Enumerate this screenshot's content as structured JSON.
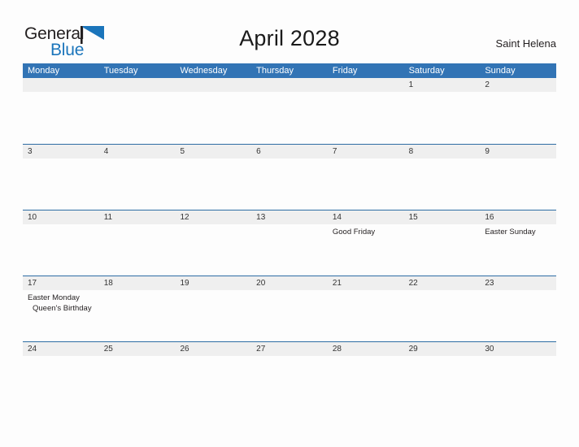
{
  "brand": {
    "word_one": "General",
    "word_two": "Blue",
    "flag_icon": "blue-flag-icon",
    "dark_color": "#231f20",
    "blue_color": "#1b75bb"
  },
  "header": {
    "title": "April 2028",
    "location": "Saint Helena"
  },
  "calendar": {
    "accent_color": "#3274b5",
    "band_color": "#efefef",
    "divider_color": "#2e6da4",
    "weekdays": [
      "Monday",
      "Tuesday",
      "Wednesday",
      "Thursday",
      "Friday",
      "Saturday",
      "Sunday"
    ],
    "weeks": [
      {
        "days": [
          {
            "num": "",
            "events": []
          },
          {
            "num": "",
            "events": []
          },
          {
            "num": "",
            "events": []
          },
          {
            "num": "",
            "events": []
          },
          {
            "num": "",
            "events": []
          },
          {
            "num": "1",
            "events": []
          },
          {
            "num": "2",
            "events": []
          }
        ]
      },
      {
        "days": [
          {
            "num": "3",
            "events": []
          },
          {
            "num": "4",
            "events": []
          },
          {
            "num": "5",
            "events": []
          },
          {
            "num": "6",
            "events": []
          },
          {
            "num": "7",
            "events": []
          },
          {
            "num": "8",
            "events": []
          },
          {
            "num": "9",
            "events": []
          }
        ]
      },
      {
        "days": [
          {
            "num": "10",
            "events": []
          },
          {
            "num": "11",
            "events": []
          },
          {
            "num": "12",
            "events": []
          },
          {
            "num": "13",
            "events": []
          },
          {
            "num": "14",
            "events": [
              "Good Friday"
            ]
          },
          {
            "num": "15",
            "events": []
          },
          {
            "num": "16",
            "events": [
              "Easter Sunday"
            ]
          }
        ]
      },
      {
        "days": [
          {
            "num": "17",
            "events": [
              "Easter Monday",
              "Queen's Birthday"
            ]
          },
          {
            "num": "18",
            "events": []
          },
          {
            "num": "19",
            "events": []
          },
          {
            "num": "20",
            "events": []
          },
          {
            "num": "21",
            "events": []
          },
          {
            "num": "22",
            "events": []
          },
          {
            "num": "23",
            "events": []
          }
        ]
      },
      {
        "days": [
          {
            "num": "24",
            "events": []
          },
          {
            "num": "25",
            "events": []
          },
          {
            "num": "26",
            "events": []
          },
          {
            "num": "27",
            "events": []
          },
          {
            "num": "28",
            "events": []
          },
          {
            "num": "29",
            "events": []
          },
          {
            "num": "30",
            "events": []
          }
        ]
      }
    ]
  }
}
